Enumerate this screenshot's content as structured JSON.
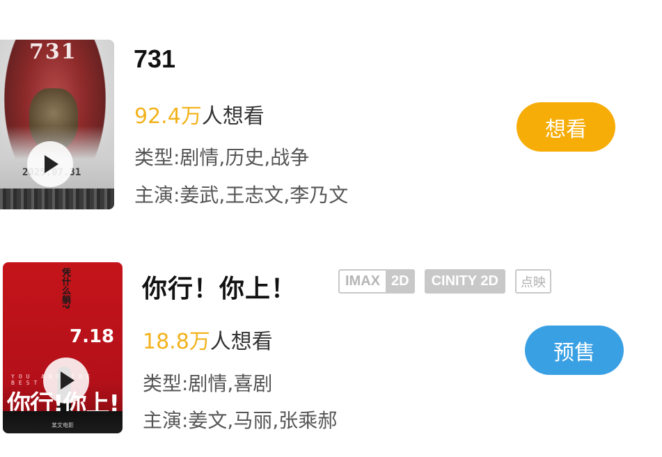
{
  "movies": [
    {
      "title": "731",
      "poster": {
        "title_text": "731",
        "date_text": "2025.07.31"
      },
      "want_count": "92.4万",
      "want_suffix": "人想看",
      "genre": "类型:剧情,历史,战争",
      "cast": "主演:姜武,王志文,李乃文",
      "button_label": "想看",
      "button_color": "#f7ad08"
    },
    {
      "title": "你行！你上！",
      "poster": {
        "vertical_text": "凭什么躺?",
        "number_text": "7.18",
        "sub_text": "YOU ARE THE BEST",
        "big_title": "你行!你上!",
        "studio": "某文电影"
      },
      "tags": {
        "imax_a": "IMAX",
        "imax_b": "2D",
        "cinity": "CINITY 2D",
        "preview": "点映"
      },
      "want_count": "18.8万",
      "want_suffix": "人想看",
      "genre": "类型:剧情,喜剧",
      "cast": "主演:姜文,马丽,张乘郝",
      "button_label": "预售",
      "button_color": "#3aa0e4"
    }
  ],
  "colors": {
    "want_count": "#f3b21b",
    "tag_gray": "#c8c8c8"
  }
}
